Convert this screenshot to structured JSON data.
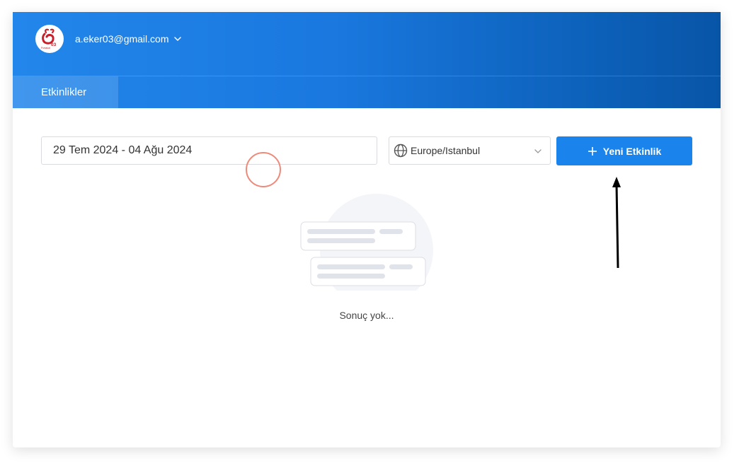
{
  "header": {
    "account_email": "a.eker03@gmail.com",
    "logo_text": "03",
    "logo_subtext": "Portakal"
  },
  "tabs": [
    {
      "label": "Etkinlikler",
      "active": true
    }
  ],
  "filters": {
    "date_range_value": "29 Tem 2024 - 04 Ağu 2024",
    "timezone_value": "Europe/Istanbul"
  },
  "actions": {
    "new_event_label": "Yeni Etkinlik"
  },
  "empty_state": {
    "message": "Sonuç yok..."
  },
  "colors": {
    "header_start": "#2286ea",
    "header_end": "#0855a8",
    "primary_button": "#1a84ec",
    "click_indicator": "#ee8a7a",
    "logo_red": "#c8202a"
  },
  "icons": {
    "account_chevron": "chevron-down-icon",
    "timezone": "globe-icon",
    "timezone_chevron": "chevron-down-icon",
    "new_event": "plus-icon"
  }
}
